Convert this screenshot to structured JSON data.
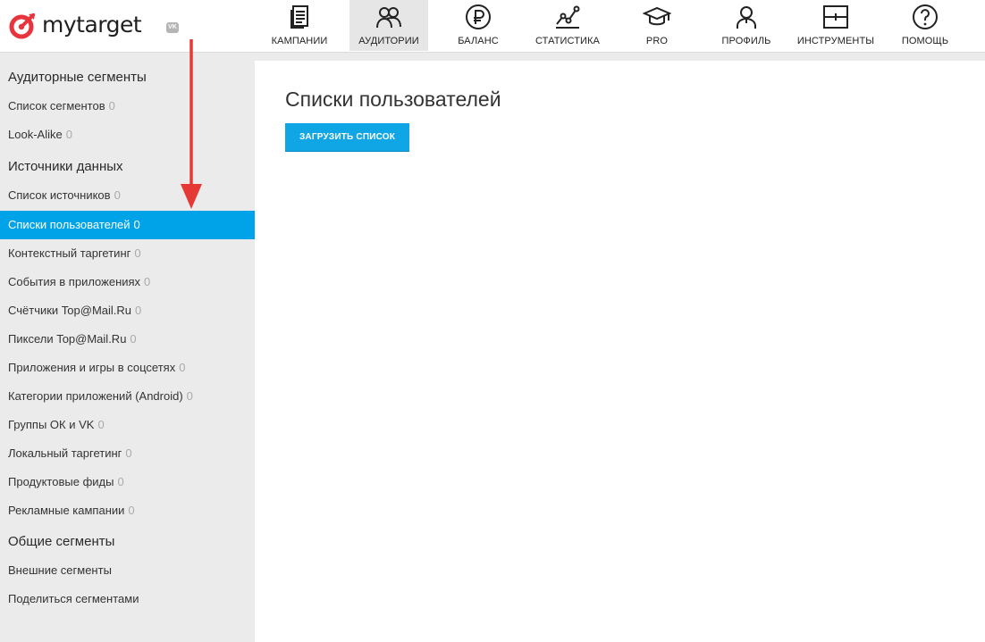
{
  "header": {
    "logo_text": "mytarget",
    "vk_badge": "VK",
    "nav": [
      {
        "label": "КАМПАНИИ",
        "icon": "campaigns-icon",
        "active": false
      },
      {
        "label": "АУДИТОРИИ",
        "icon": "audiences-icon",
        "active": true
      },
      {
        "label": "БАЛАНС",
        "icon": "ruble-icon",
        "active": false
      },
      {
        "label": "СТАТИСТИКА",
        "icon": "statistics-icon",
        "active": false
      },
      {
        "label": "PRO",
        "icon": "graduation-cap-icon",
        "active": false
      },
      {
        "label": "ПРОФИЛЬ",
        "icon": "profile-icon",
        "active": false
      },
      {
        "label": "ИНСТРУМЕНТЫ",
        "icon": "tools-icon",
        "active": false
      },
      {
        "label": "ПОМОЩЬ",
        "icon": "help-icon",
        "active": false
      }
    ]
  },
  "sidebar": {
    "sections": [
      {
        "title": "Аудиторные сегменты",
        "items": [
          {
            "label": "Список сегментов",
            "count": "0"
          },
          {
            "label": "Look-Alike",
            "count": "0"
          }
        ]
      },
      {
        "title": "Источники данных",
        "items": [
          {
            "label": "Список источников",
            "count": "0"
          },
          {
            "label": "Списки пользователей",
            "count": "0",
            "active": true
          },
          {
            "label": "Контекстный таргетинг",
            "count": "0"
          },
          {
            "label": "События в приложениях",
            "count": "0"
          },
          {
            "label": "Счётчики Top@Mail.Ru",
            "count": "0"
          },
          {
            "label": "Пиксели Top@Mail.Ru",
            "count": "0"
          },
          {
            "label": "Приложения и игры в соцсетях",
            "count": "0"
          },
          {
            "label": "Категории приложений (Android)",
            "count": "0"
          },
          {
            "label": "Группы ОК и VK",
            "count": "0"
          },
          {
            "label": "Локальный таргетинг",
            "count": "0"
          },
          {
            "label": "Продуктовые фиды",
            "count": "0"
          },
          {
            "label": "Рекламные кампании",
            "count": "0"
          }
        ]
      },
      {
        "title": "Общие сегменты",
        "items": [
          {
            "label": "Внешние сегменты"
          },
          {
            "label": "Поделиться сегментами"
          }
        ]
      }
    ]
  },
  "main": {
    "title": "Списки пользователей",
    "upload_button": "ЗАГРУЗИТЬ СПИСОК"
  },
  "colors": {
    "accent": "#00a3e8",
    "brand_red": "#e8343d",
    "annotation_arrow": "#e53935"
  }
}
